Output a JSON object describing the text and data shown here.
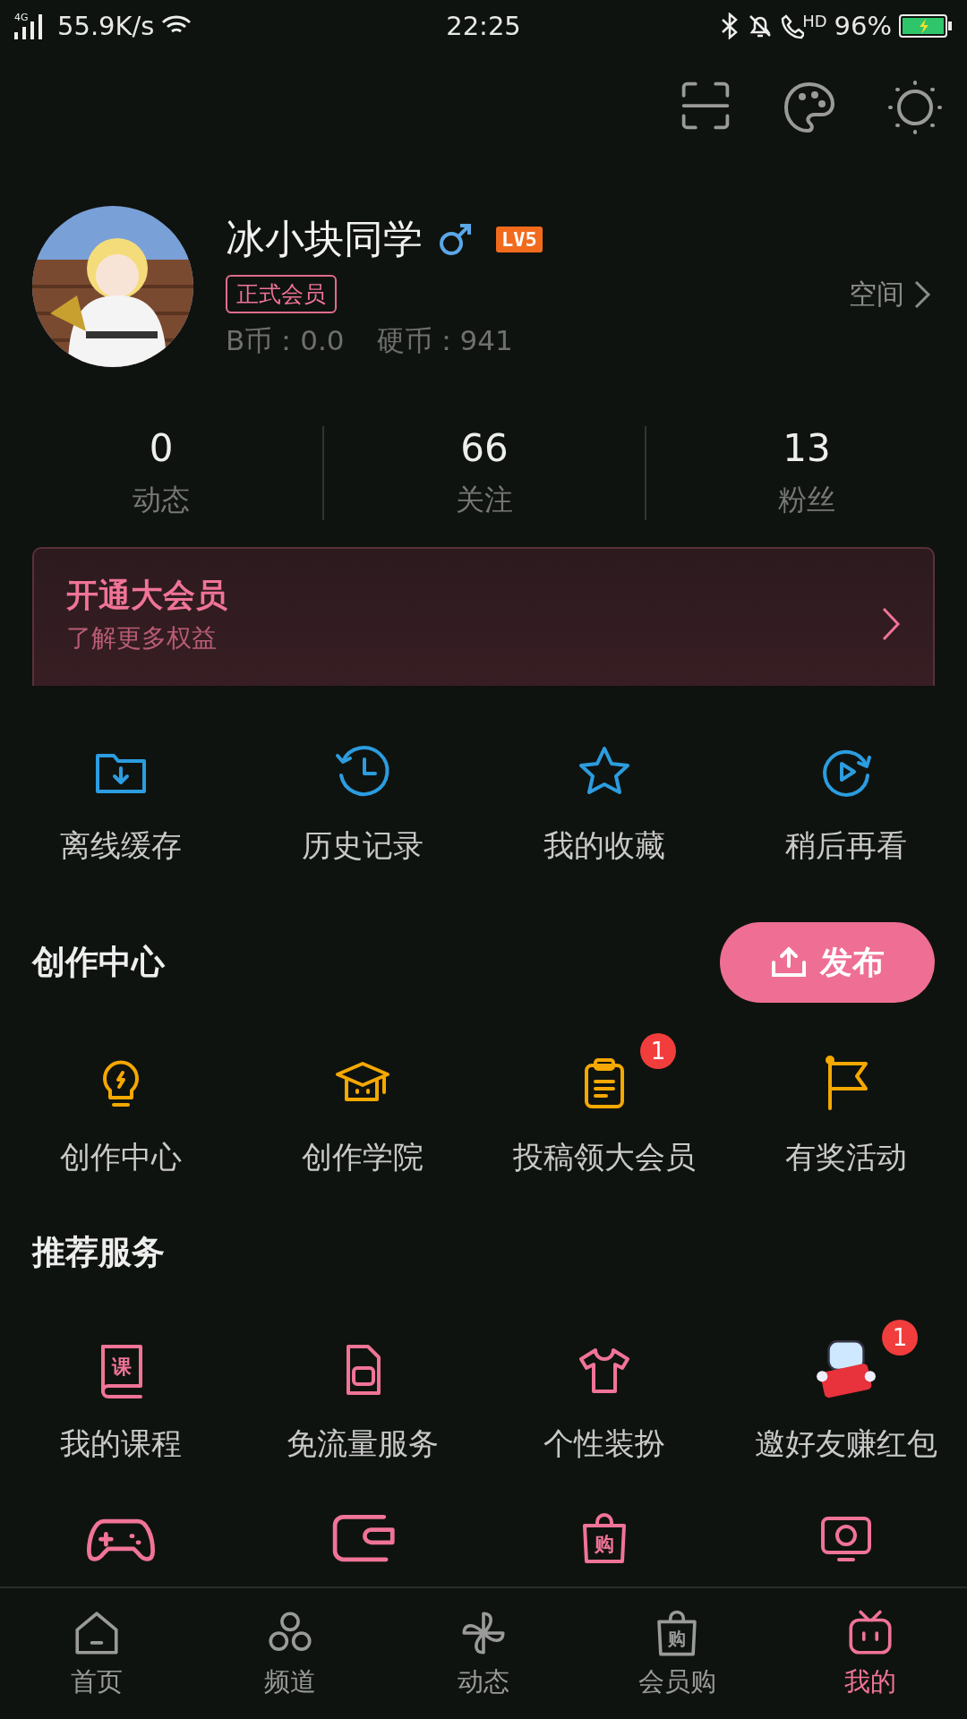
{
  "status_bar": {
    "network": "4G",
    "speed": "55.9K/s",
    "time": "22:25",
    "call_badge": "HD",
    "battery": "96%"
  },
  "profile": {
    "name": "冰小块同学",
    "level": "LV5",
    "member_tag": "正式会员",
    "space_link": "空间",
    "bcoin": "B币：0.0",
    "coins": "硬币：941"
  },
  "stats": [
    {
      "value": "0",
      "label": "动态"
    },
    {
      "value": "66",
      "label": "关注"
    },
    {
      "value": "13",
      "label": "粉丝"
    }
  ],
  "vip_banner": {
    "title": "开通大会员",
    "subtitle": "了解更多权益"
  },
  "quick_actions": [
    {
      "label": "离线缓存"
    },
    {
      "label": "历史记录"
    },
    {
      "label": "我的收藏"
    },
    {
      "label": "稍后再看"
    }
  ],
  "creation": {
    "title": "创作中心",
    "publish_button": "发布",
    "items": [
      {
        "label": "创作中心"
      },
      {
        "label": "创作学院"
      },
      {
        "label": "投稿领大会员",
        "badge": "1"
      },
      {
        "label": "有奖活动"
      }
    ]
  },
  "services": {
    "title": "推荐服务",
    "items": [
      {
        "label": "我的课程",
        "glyph": "课"
      },
      {
        "label": "免流量服务"
      },
      {
        "label": "个性装扮"
      },
      {
        "label": "邀好友赚红包",
        "badge": "1"
      }
    ],
    "partly_hidden_row": {
      "bag_glyph": "购"
    }
  },
  "tab_bar": [
    {
      "label": "首页",
      "selected": false
    },
    {
      "label": "频道",
      "selected": false
    },
    {
      "label": "动态",
      "selected": false
    },
    {
      "label": "会员购",
      "selected": false,
      "glyph": "购"
    },
    {
      "label": "我的",
      "selected": true
    }
  ]
}
